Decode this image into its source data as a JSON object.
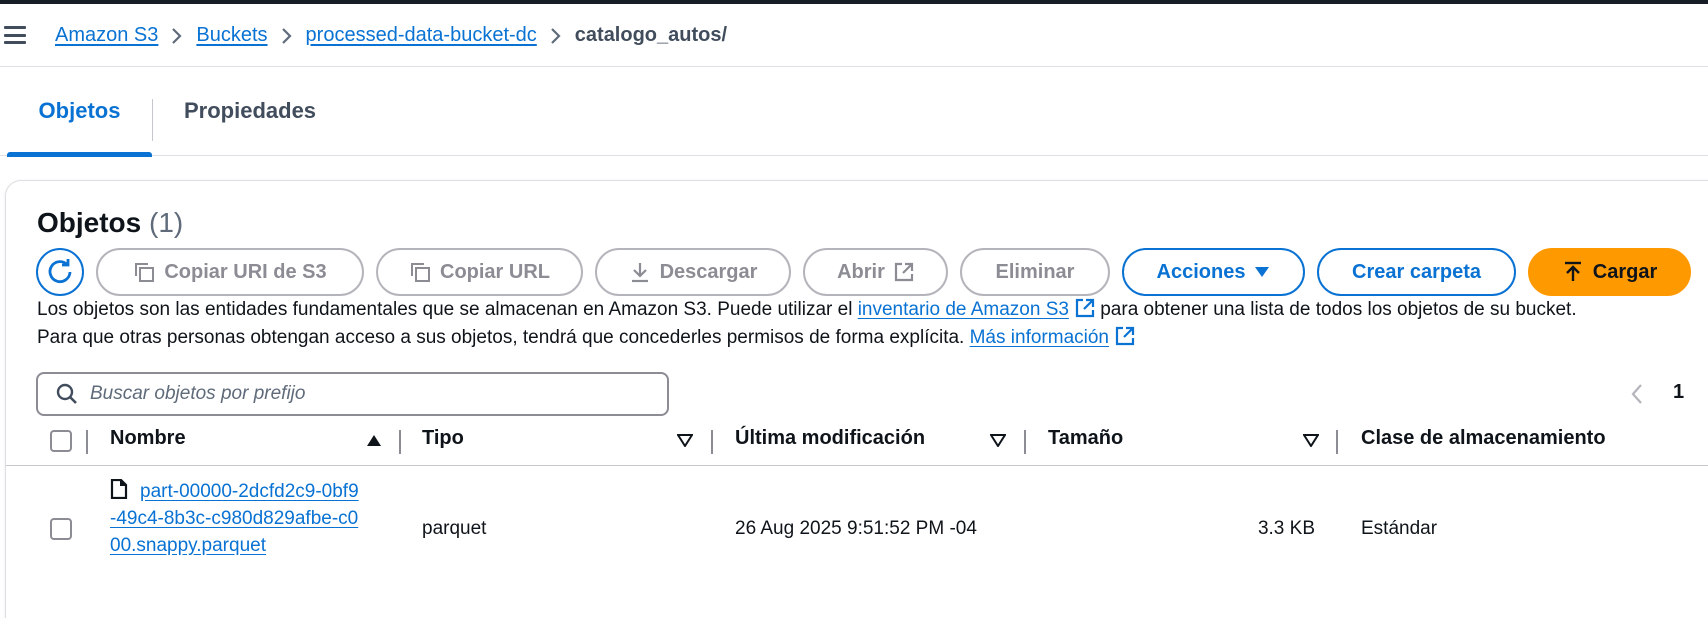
{
  "breadcrumb": {
    "items": [
      "Amazon S3",
      "Buckets",
      "processed-data-bucket-dc"
    ],
    "current": "catalogo_autos/"
  },
  "tabs": [
    {
      "label": "Objetos",
      "active": true
    },
    {
      "label": "Propiedades",
      "active": false
    }
  ],
  "panel": {
    "title": "Objetos",
    "count": "(1)",
    "toolbar": {
      "copy_uri": "Copiar URI de S3",
      "copy_url": "Copiar URL",
      "download": "Descargar",
      "open": "Abrir",
      "delete": "Eliminar",
      "actions": "Acciones",
      "create_folder": "Crear carpeta",
      "upload": "Cargar"
    },
    "description": {
      "line1_before": "Los objetos son las entidades fundamentales que se almacenan en Amazon S3. Puede utilizar el ",
      "line1_link": "inventario de Amazon S3",
      "line1_after": " para obtener una lista de todos los objetos de su bucket.",
      "line2_before": "Para que otras personas obtengan acceso a sus objetos, tendrá que concederles permisos de forma explícita. ",
      "line2_link": "Más información"
    },
    "search": {
      "placeholder": "Buscar objetos por prefijo",
      "value": ""
    },
    "pagination": {
      "current_page": "1"
    },
    "table": {
      "columns": [
        "Nombre",
        "Tipo",
        "Última modificación",
        "Tamaño",
        "Clase de almacenamiento"
      ],
      "rows": [
        {
          "name": "part-00000-2dcfd2c9-0bf9-49c4-8b3c-c980d829afbe-c000.snappy.parquet",
          "type": "parquet",
          "last_modified": "26 Aug 2025 9:51:52 PM -04",
          "size": "3.3 KB",
          "storage_class": "Estándar"
        }
      ]
    }
  },
  "colors": {
    "link": "#0972d3",
    "primary_button": "#ff9900",
    "disabled": "#8c8c94",
    "text": "#0f141a"
  },
  "icons": [
    "menu-icon",
    "chevron-right-icon",
    "refresh-icon",
    "copy-icon",
    "download-icon",
    "external-link-icon",
    "caret-down-icon",
    "upload-icon",
    "search-icon",
    "chevron-left-icon",
    "sort-ascending-icon",
    "sort-descending-icon",
    "file-icon"
  ]
}
